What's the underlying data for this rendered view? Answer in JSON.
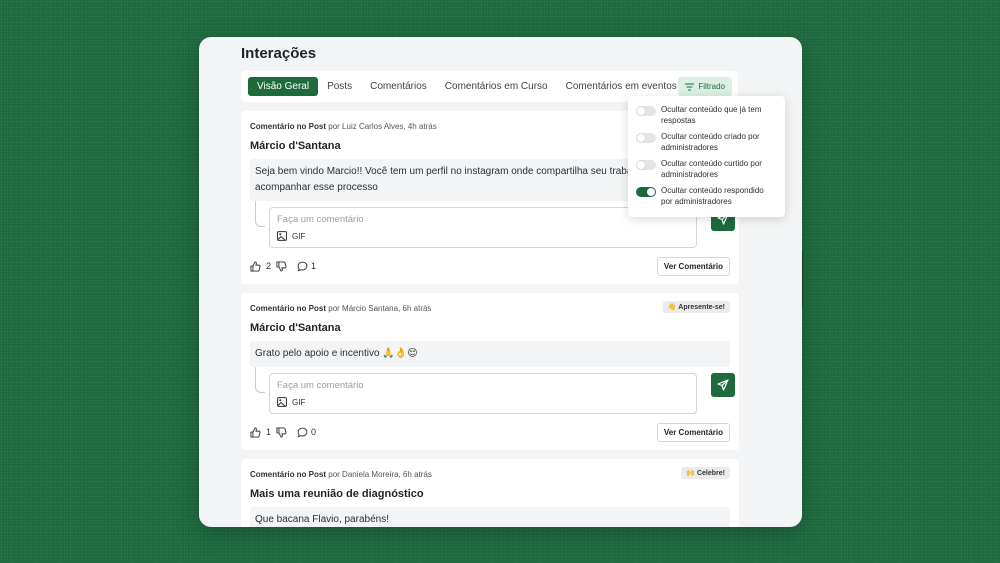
{
  "page": {
    "title": "Interações"
  },
  "tabs": [
    "Visão Geral",
    "Posts",
    "Comentários",
    "Comentários em Curso",
    "Comentários em eventos"
  ],
  "filter": {
    "label": "Filtrado"
  },
  "filter_options": [
    {
      "label": "Ocultar conteúdo que já tem respostas",
      "on": false
    },
    {
      "label": "Ocultar conteúdo criado por administradores",
      "on": false
    },
    {
      "label": "Ocultar conteúdo curtido por administradores",
      "on": false
    },
    {
      "label": "Ocultar conteúdo respondido por administradores",
      "on": true
    }
  ],
  "common": {
    "type_label": "Comentário no Post",
    "by": "por",
    "comment_placeholder": "Faça um comentário",
    "gif_label": "GIF",
    "view_comment": "Ver Comentário"
  },
  "posts": [
    {
      "author_time": "Luiz Carlos Alves, 4h atrás",
      "badge": "",
      "title": "Márcio d'Santana",
      "body": "Seja bem vindo Marcio!! Você tem um perfil no instagram onde compartilha seu trabalho? Gostaria de acompanhar esse processo",
      "likes": "2",
      "comments": "1"
    },
    {
      "author_time": "Márcio Santana, 6h atrás",
      "badge": "👋 Apresente-se!",
      "title": "Márcio d'Santana",
      "body": "Grato pelo apoio e incentivo 🙏👌😌",
      "likes": "1",
      "comments": "0"
    },
    {
      "author_time": "Daniela Moreira, 6h atrás",
      "badge": "🙌 Celebre!",
      "title": "Mais uma reunião de diagnóstico",
      "body": "Que bacana Flavio, parabéns!",
      "likes": "",
      "comments": ""
    }
  ],
  "colors": {
    "brand": "#1d6b3d",
    "background": "#1e6b3f"
  }
}
